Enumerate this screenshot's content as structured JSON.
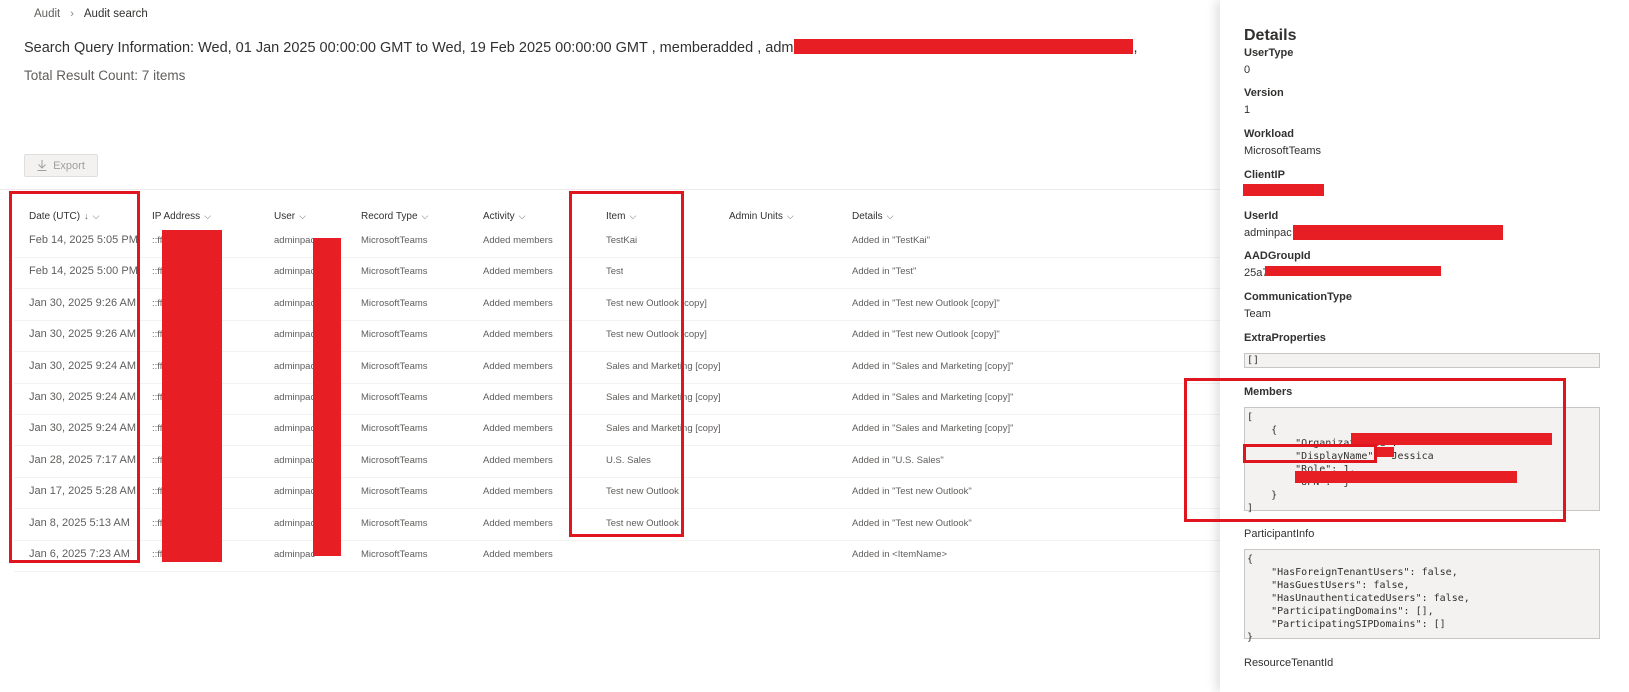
{
  "breadcrumb": {
    "root": "Audit",
    "separator": "›",
    "current": "Audit search"
  },
  "query_info": "Search Query Information: Wed, 01 Jan 2025 00:00:00 GMT to Wed, 19 Feb 2025 00:00:00 GMT , memberadded , adm",
  "query_info_tail": ",",
  "total_count": "Total Result Count: 7 items",
  "export_label": "Export",
  "columns": {
    "date": "Date (UTC)",
    "ip": "IP Address",
    "user": "User",
    "record_type": "Record Type",
    "activity": "Activity",
    "item": "Item",
    "admin_units": "Admin Units",
    "details": "Details"
  },
  "sort_arrow": "↓",
  "chevron": "⌵",
  "rows": [
    {
      "date": "Feb 14, 2025 5:05 PM",
      "ip": "::ff",
      "user": "adminpac",
      "record_type": "MicrosoftTeams",
      "activity": "Added members",
      "item": "TestKai",
      "details": "Added in \"TestKai\""
    },
    {
      "date": "Feb 14, 2025 5:00 PM",
      "ip": "::ff",
      "user": "adminpac",
      "record_type": "MicrosoftTeams",
      "activity": "Added members",
      "item": "Test",
      "details": "Added in \"Test\""
    },
    {
      "date": "Jan 30, 2025 9:26 AM",
      "ip": "::ff",
      "user": "adminpac",
      "record_type": "MicrosoftTeams",
      "activity": "Added members",
      "item": "Test new Outlook [copy]",
      "details": "Added in \"Test new Outlook [copy]\""
    },
    {
      "date": "Jan 30, 2025 9:26 AM",
      "ip": "::ff",
      "user": "adminpac",
      "record_type": "MicrosoftTeams",
      "activity": "Added members",
      "item": "Test new Outlook [copy]",
      "details": "Added in \"Test new Outlook [copy]\""
    },
    {
      "date": "Jan 30, 2025 9:24 AM",
      "ip": "::ff",
      "user": "adminpac",
      "record_type": "MicrosoftTeams",
      "activity": "Added members",
      "item": "Sales and Marketing [copy]",
      "details": "Added in \"Sales and Marketing [copy]\""
    },
    {
      "date": "Jan 30, 2025 9:24 AM",
      "ip": "::ff",
      "user": "adminpac",
      "record_type": "MicrosoftTeams",
      "activity": "Added members",
      "item": "Sales and Marketing [copy]",
      "details": "Added in \"Sales and Marketing [copy]\""
    },
    {
      "date": "Jan 30, 2025 9:24 AM",
      "ip": "::ff",
      "user": "adminpac",
      "record_type": "MicrosoftTeams",
      "activity": "Added members",
      "item": "Sales and Marketing [copy]",
      "details": "Added in \"Sales and Marketing [copy]\""
    },
    {
      "date": "Jan 28, 2025 7:17 AM",
      "ip": "::ff",
      "user": "adminpac",
      "record_type": "MicrosoftTeams",
      "activity": "Added members",
      "item": "U.S. Sales",
      "details": "Added in \"U.S. Sales\""
    },
    {
      "date": "Jan 17, 2025 5:28 AM",
      "ip": "::ff",
      "user": "adminpac",
      "record_type": "MicrosoftTeams",
      "activity": "Added members",
      "item": "Test new Outlook",
      "details": "Added in \"Test new Outlook\""
    },
    {
      "date": "Jan 8, 2025 5:13 AM",
      "ip": "::ff",
      "user": "adminpac",
      "record_type": "MicrosoftTeams",
      "activity": "Added members",
      "item": "Test new Outlook",
      "details": "Added in \"Test new Outlook\""
    },
    {
      "date": "Jan 6, 2025 7:23 AM",
      "ip": "::ff",
      "user": "adminpac",
      "record_type": "MicrosoftTeams",
      "activity": "Added members",
      "item": "",
      "details": "Added in <ItemName>"
    }
  ],
  "details_pane": {
    "title": "Details",
    "user_type_label": "UserType",
    "user_type": "0",
    "version_label": "Version",
    "version": "1",
    "workload_label": "Workload",
    "workload": "MicrosoftTeams",
    "client_ip_label": "ClientIP",
    "user_id_label": "UserId",
    "user_id": "adminpac",
    "aad_group_label": "AADGroupId",
    "aad_group": "25a7",
    "comm_type_label": "CommunicationType",
    "comm_type": "Team",
    "extra_props_label": "ExtraProperties",
    "extra_props": "[]",
    "members_label": "Members",
    "members_json": "[\n    {\n        \"OrganizationId\": \"\n        \"DisplayName\": \"Jessica\n        \"Role\": 1,\n        \"UPN\": \"j\n    }\n]",
    "participant_label": "ParticipantInfo",
    "participant_json": "{\n    \"HasForeignTenantUsers\": false,\n    \"HasGuestUsers\": false,\n    \"HasUnauthenticatedUsers\": false,\n    \"ParticipatingDomains\": [],\n    \"ParticipatingSIPDomains\": []\n}",
    "resource_tenant_label": "ResourceTenantId"
  },
  "colors": {
    "redaction": "#e81e25",
    "highlight_box": "#e0161e"
  }
}
